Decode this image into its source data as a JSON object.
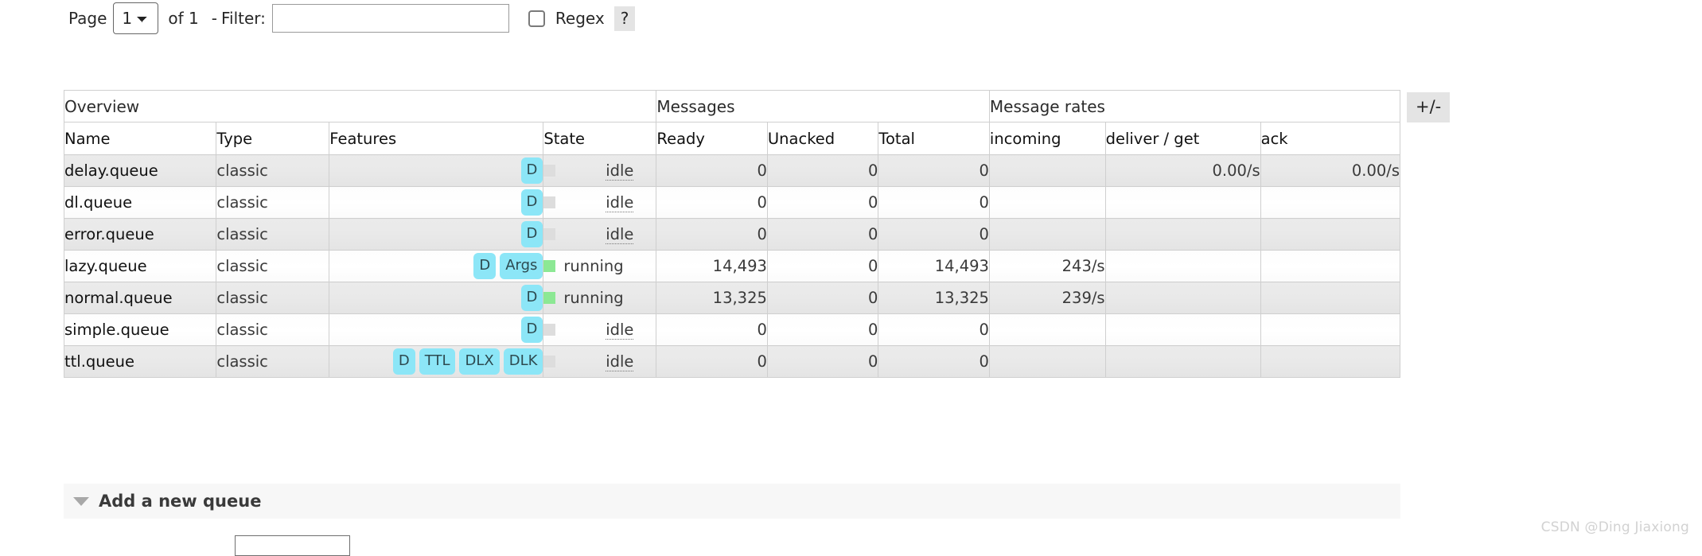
{
  "filter_bar": {
    "page_label": "Page",
    "page_value": "1",
    "page_options": [
      "1"
    ],
    "of_label": "of 1",
    "dash": "-",
    "filter_label": "Filter:",
    "filter_value": "",
    "filter_placeholder": "",
    "regex_label": "Regex",
    "regex_help": "?",
    "regex_checked": false
  },
  "table": {
    "group_headers": [
      {
        "label": "Overview",
        "span": 4
      },
      {
        "label": "Messages",
        "span": 3
      },
      {
        "label": "Message rates",
        "span": 3
      }
    ],
    "columns": [
      {
        "label": "Name",
        "align": "left",
        "bold": true
      },
      {
        "label": "Type",
        "align": "left",
        "bold": true
      },
      {
        "label": "Features",
        "align": "left",
        "bold": false
      },
      {
        "label": "State",
        "align": "left",
        "bold": true
      },
      {
        "label": "Ready",
        "align": "left",
        "bold": true
      },
      {
        "label": "Unacked",
        "align": "left",
        "bold": true
      },
      {
        "label": "Total",
        "align": "left",
        "bold": true
      },
      {
        "label": "incoming",
        "align": "left",
        "bold": true
      },
      {
        "label": "deliver / get",
        "align": "left",
        "bold": true
      },
      {
        "label": "ack",
        "align": "left",
        "bold": true
      }
    ],
    "rows": [
      {
        "name": "delay.queue",
        "type": "classic",
        "features": [
          "D"
        ],
        "state": "idle",
        "state_kind": "idle",
        "ready": "0",
        "unacked": "0",
        "total": "0",
        "incoming": "",
        "deliver_get": "0.00/s",
        "ack": "0.00/s"
      },
      {
        "name": "dl.queue",
        "type": "classic",
        "features": [
          "D"
        ],
        "state": "idle",
        "state_kind": "idle",
        "ready": "0",
        "unacked": "0",
        "total": "0",
        "incoming": "",
        "deliver_get": "",
        "ack": ""
      },
      {
        "name": "error.queue",
        "type": "classic",
        "features": [
          "D"
        ],
        "state": "idle",
        "state_kind": "idle",
        "ready": "0",
        "unacked": "0",
        "total": "0",
        "incoming": "",
        "deliver_get": "",
        "ack": ""
      },
      {
        "name": "lazy.queue",
        "type": "classic",
        "features": [
          "D",
          "Args"
        ],
        "state": "running",
        "state_kind": "running",
        "ready": "14,493",
        "unacked": "0",
        "total": "14,493",
        "incoming": "243/s",
        "deliver_get": "",
        "ack": ""
      },
      {
        "name": "normal.queue",
        "type": "classic",
        "features": [
          "D"
        ],
        "state": "running",
        "state_kind": "running",
        "ready": "13,325",
        "unacked": "0",
        "total": "13,325",
        "incoming": "239/s",
        "deliver_get": "",
        "ack": ""
      },
      {
        "name": "simple.queue",
        "type": "classic",
        "features": [
          "D"
        ],
        "state": "idle",
        "state_kind": "idle",
        "ready": "0",
        "unacked": "0",
        "total": "0",
        "incoming": "",
        "deliver_get": "",
        "ack": ""
      },
      {
        "name": "ttl.queue",
        "type": "classic",
        "features": [
          "D",
          "TTL",
          "DLX",
          "DLK"
        ],
        "state": "idle",
        "state_kind": "idle",
        "ready": "0",
        "unacked": "0",
        "total": "0",
        "incoming": "",
        "deliver_get": "",
        "ack": ""
      }
    ]
  },
  "plus_minus": {
    "label": "+/-"
  },
  "add_queue": {
    "title": "Add a new queue",
    "input_value": ""
  },
  "watermark": {
    "text": "CSDN @Ding Jiaxiong"
  },
  "colors": {
    "badge_bg": "#8ce6f7",
    "state_running": "#8ce894",
    "state_idle": "#dddddd",
    "row_odd": "#e9e9e9",
    "row_even": "#ffffff",
    "border": "#cfcfcf",
    "button_bg": "#e4e4e4",
    "watermark": "#d2d2d2"
  }
}
